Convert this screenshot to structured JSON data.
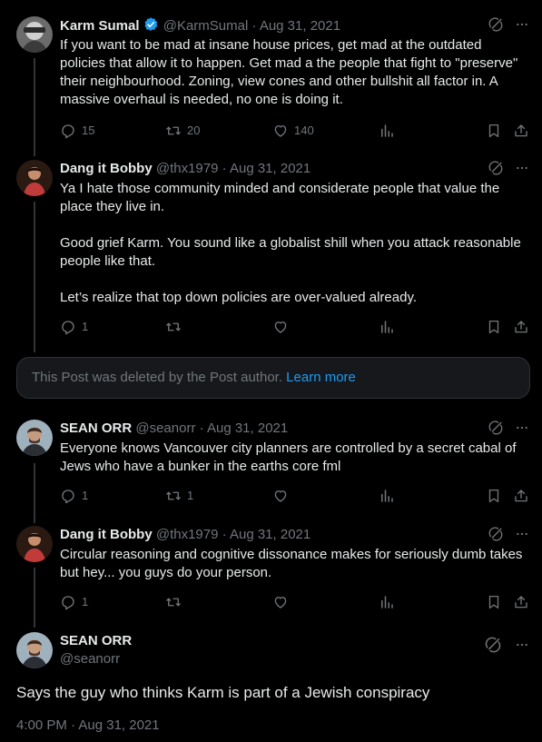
{
  "colors": {
    "background": "#000000",
    "text": "#e7e9ea",
    "muted": "#71767b",
    "link": "#1d9bf0",
    "verified": "#1d9bf0"
  },
  "posts": [
    {
      "name": "Karm Sumal",
      "verified": true,
      "handle": "@KarmSumal",
      "date": "Aug 31, 2021",
      "text": "If you want to be mad at insane house prices, get mad at the outdated policies that allow it to happen. Get mad a the people that fight to \"preserve\" their neighbourhood. Zoning, view cones and other bullshit all factor in. A massive overhaul is needed, no one is doing it.",
      "replies": "15",
      "reposts": "20",
      "likes": "140"
    },
    {
      "name": "Dang it Bobby",
      "handle": "@thx1979",
      "date": "Aug 31, 2021",
      "text": "Ya I hate those community minded and considerate people that value the place they live in.\n\nGood grief Karm. You sound like a globalist shill when you attack reasonable people like that.\n\nLet’s realize that top down policies are over-valued already.",
      "replies": "1",
      "reposts": "",
      "likes": ""
    },
    {
      "name": "SEAN ORR",
      "handle": "@seanorr",
      "date": "Aug 31, 2021",
      "text": "Everyone knows Vancouver city planners are controlled by a secret cabal of Jews who have a bunker in the earths core fml",
      "replies": "1",
      "reposts": "1",
      "likes": ""
    },
    {
      "name": "Dang it Bobby",
      "handle": "@thx1979",
      "date": "Aug 31, 2021",
      "text": "Circular reasoning and cognitive dissonance makes for seriously dumb takes but hey... you guys do your person.",
      "replies": "1",
      "reposts": "",
      "likes": ""
    }
  ],
  "deleted_notice": {
    "text": "This Post was deleted by the Post author.",
    "link": "Learn more"
  },
  "main_post": {
    "name": "SEAN ORR",
    "handle": "@seanorr",
    "text": "Says the guy who thinks Karm is part of a Jewish conspiracy",
    "timestamp": "4:00 PM · Aug 31, 2021"
  },
  "icons": [
    "grok-icon",
    "more-icon",
    "reply-icon",
    "repost-icon",
    "like-icon",
    "views-icon",
    "bookmark-icon",
    "share-icon",
    "verified-icon"
  ]
}
